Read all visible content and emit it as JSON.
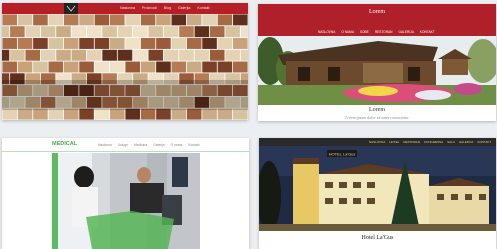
{
  "cards": [
    {
      "nav": [
        "Naslovna",
        "Proizvodi",
        "Blog",
        "Galerija",
        "Kontakt"
      ]
    },
    {
      "title": "Lorem",
      "nav": [
        "NASLOVNA",
        "O NAMA",
        "SOBE",
        "RESTORAN",
        "GALERIJA",
        "KONTAKT"
      ],
      "name": "Lorem",
      "tagline": "Lorem ipsum dolor sit amet consectetur"
    },
    {
      "logo": "MEDICAL",
      "nav": [
        "Naslovna",
        "Usluge",
        "Medicina",
        "Galerija",
        "O nama",
        "Kontakt"
      ]
    },
    {
      "nav": [
        "NASLOVNA",
        "HOTEL",
        "RESTORAN",
        "KONGRESNA",
        "SALA",
        "GALERIJA",
        "KONTAKT"
      ],
      "sign": "HOTEL La'Gus",
      "name": "Hotel La'Gus"
    }
  ],
  "colors": {
    "red_accent": "#b71f26",
    "green_accent": "#43b049",
    "dark_bar": "#2a2a2a",
    "gold_text": "#e6d37a"
  }
}
